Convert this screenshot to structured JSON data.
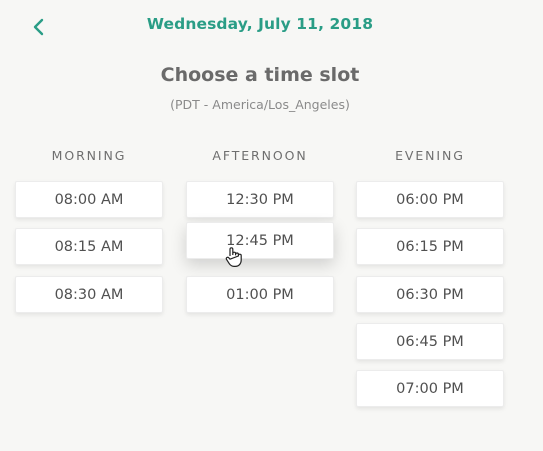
{
  "header": {
    "back_icon": "chevron-left-icon",
    "date": "Wednesday, July 11, 2018",
    "heading": "Choose a time slot",
    "timezone": "(PDT - America/Los_Angeles)",
    "accent_color": "#2a9d86"
  },
  "columns": {
    "morning": {
      "label": "MORNING",
      "slots": [
        "08:00 AM",
        "08:15 AM",
        "08:30 AM"
      ]
    },
    "afternoon": {
      "label": "AFTERNOON",
      "slots": [
        "12:30 PM",
        "12:45 PM",
        "01:00 PM"
      ],
      "hovered_slot": "12:45 PM"
    },
    "evening": {
      "label": "EVENING",
      "slots": [
        "06:00 PM",
        "06:15 PM",
        "06:30 PM",
        "06:45 PM",
        "07:00 PM"
      ]
    }
  },
  "cursor": {
    "icon": "hand-pointer-icon"
  }
}
